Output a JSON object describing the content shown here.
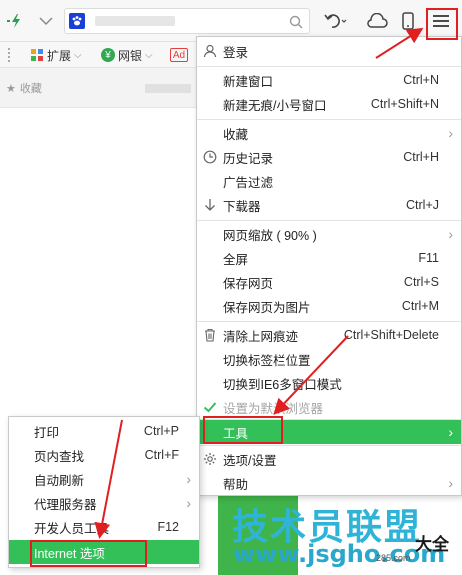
{
  "toolbar": {
    "icons": [
      "speed-icon",
      "chevron-down-icon",
      "site-favicon",
      "search-icon",
      "undo-icon",
      "cloud-icon",
      "phone-icon",
      "menu-icon"
    ]
  },
  "bookmarks": {
    "items": [
      {
        "label": "扩展",
        "icon": "extension-icon"
      },
      {
        "label": "网银",
        "icon": "bank-icon"
      },
      {
        "label": "Ad",
        "icon": "ad-icon"
      }
    ]
  },
  "tab": {
    "label": "收藏"
  },
  "main_menu": {
    "login": "登录",
    "items": [
      {
        "label": "新建窗口",
        "shortcut": "Ctrl+N"
      },
      {
        "label": "新建无痕/小号窗口",
        "shortcut": "Ctrl+Shift+N"
      },
      {
        "label": "收藏",
        "submenu": true
      },
      {
        "label": "历史记录",
        "shortcut": "Ctrl+H",
        "icon": "clock-icon"
      },
      {
        "label": "广告过滤"
      },
      {
        "label": "下载器",
        "shortcut": "Ctrl+J",
        "icon": "download-icon"
      },
      {
        "label": "网页缩放 ( 90% )",
        "submenu": true
      },
      {
        "label": "全屏",
        "shortcut": "F11"
      },
      {
        "label": "保存网页",
        "shortcut": "Ctrl+S"
      },
      {
        "label": "保存网页为图片",
        "shortcut": "Ctrl+M"
      },
      {
        "label": "清除上网痕迹",
        "shortcut": "Ctrl+Shift+Delete",
        "icon": "trash-icon"
      },
      {
        "label": "切换标签栏位置"
      },
      {
        "label": "切换到IE6多窗口模式"
      },
      {
        "label": "设置为默认浏览器",
        "disabled": true,
        "icon": "check-icon"
      },
      {
        "label": "工具",
        "submenu": true,
        "highlighted": true
      },
      {
        "label": "选项/设置",
        "icon": "gear-icon"
      },
      {
        "label": "帮助",
        "submenu": true
      }
    ]
  },
  "tools_submenu": {
    "items": [
      {
        "label": "打印",
        "shortcut": "Ctrl+P"
      },
      {
        "label": "页内查找",
        "shortcut": "Ctrl+F"
      },
      {
        "label": "自动刷新",
        "submenu": true
      },
      {
        "label": "代理服务器",
        "submenu": true
      },
      {
        "label": "开发人员工具",
        "shortcut": "F12"
      },
      {
        "label": "Internet 选项",
        "highlighted": true
      }
    ]
  },
  "watermark": {
    "title": "技术员联盟",
    "url": "www.jsgho.com",
    "right": "大全",
    "small": "285.com"
  },
  "colors": {
    "highlight": "#33c058",
    "annotation": "#e02020",
    "watermark": "#2fb4d8"
  }
}
